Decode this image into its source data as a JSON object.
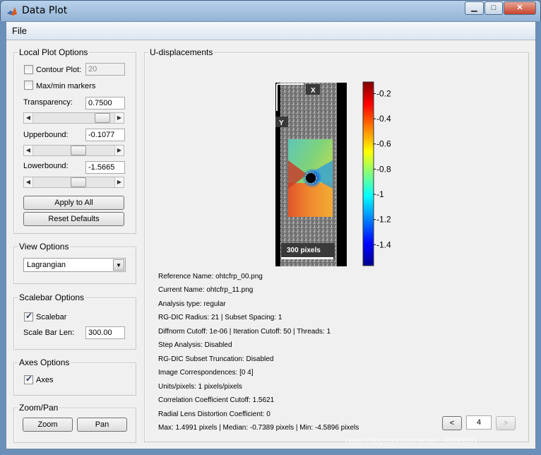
{
  "window": {
    "title": "Data Plot",
    "minimize_glyph": "▁",
    "maximize_glyph": "□",
    "close_glyph": "✕"
  },
  "menu": {
    "file": "File"
  },
  "local_plot_options": {
    "title": "Local Plot Options",
    "contour_plot": {
      "label": "Contour Plot:",
      "checked": false,
      "value": "20"
    },
    "maxmin_markers": {
      "label": "Max/min markers",
      "checked": false
    },
    "transparency": {
      "label": "Transparency:",
      "value": "0.7500",
      "slider_fraction": 0.75
    },
    "upperbound": {
      "label": "Upperbound:",
      "value": "-0.1077",
      "slider_fraction": 0.45
    },
    "lowerbound": {
      "label": "Lowerbound:",
      "value": "-1.5665",
      "slider_fraction": 0.45
    },
    "apply_all": "Apply to All",
    "reset_defaults": "Reset Defaults"
  },
  "view_options": {
    "title": "View Options",
    "selected": "Lagrangian"
  },
  "scalebar_options": {
    "title": "Scalebar Options",
    "scalebar": {
      "label": "Scalebar",
      "checked": true
    },
    "scale_bar_len": {
      "label": "Scale Bar Len:",
      "value": "300.00"
    }
  },
  "axes_options": {
    "title": "Axes Options",
    "axes": {
      "label": "Axes",
      "checked": true
    }
  },
  "zoom_pan": {
    "title": "Zoom/Pan",
    "zoom": "Zoom",
    "pan": "Pan"
  },
  "plot_panel": {
    "title": "U-displacements",
    "axis_x_label": "X",
    "axis_y_label": "Y",
    "scalebar_label": "300 pixels",
    "colorbar": {
      "ticks": [
        "-0.2",
        "-0.4",
        "-0.6",
        "-0.8",
        "-1",
        "-1.2",
        "-1.4"
      ],
      "tick_values": [
        -0.2,
        -0.4,
        -0.6,
        -0.8,
        -1.0,
        -1.2,
        -1.4
      ],
      "range": [
        -0.1077,
        -1.5665
      ]
    }
  },
  "info": {
    "reference_name": "Reference Name: ohtcfrp_00.png",
    "current_name": "Current Name: ohtcfrp_11.png",
    "analysis_type": "Analysis type: regular",
    "rgdic_radius": "RG-DIC Radius: 21 | Subset Spacing: 1",
    "diffnorm": "Diffnorm Cutoff: 1e-06 | Iteration Cutoff: 50 | Threads: 1",
    "step_analysis": "Step Analysis: Disabled",
    "subset_truncation": "RG-DIC Subset Truncation: Disabled",
    "image_correspondences": "Image Correspondences: [0 4]",
    "units_pixels": "Units/pixels: 1 pixels/pixels",
    "correlation_cutoff": "Correlation Coefficient Cutoff: 1.5621",
    "radial_distortion": "Radial Lens Distortion Coefficient: 0",
    "stats": "Max: 1.4991 pixels | Median: -0.7389 pixels | Min: -4.5896 pixels"
  },
  "nav": {
    "prev": "<",
    "frame": "4",
    "next": ">"
  },
  "watermark": "https://blog.csdn.net/weixin_46045281"
}
